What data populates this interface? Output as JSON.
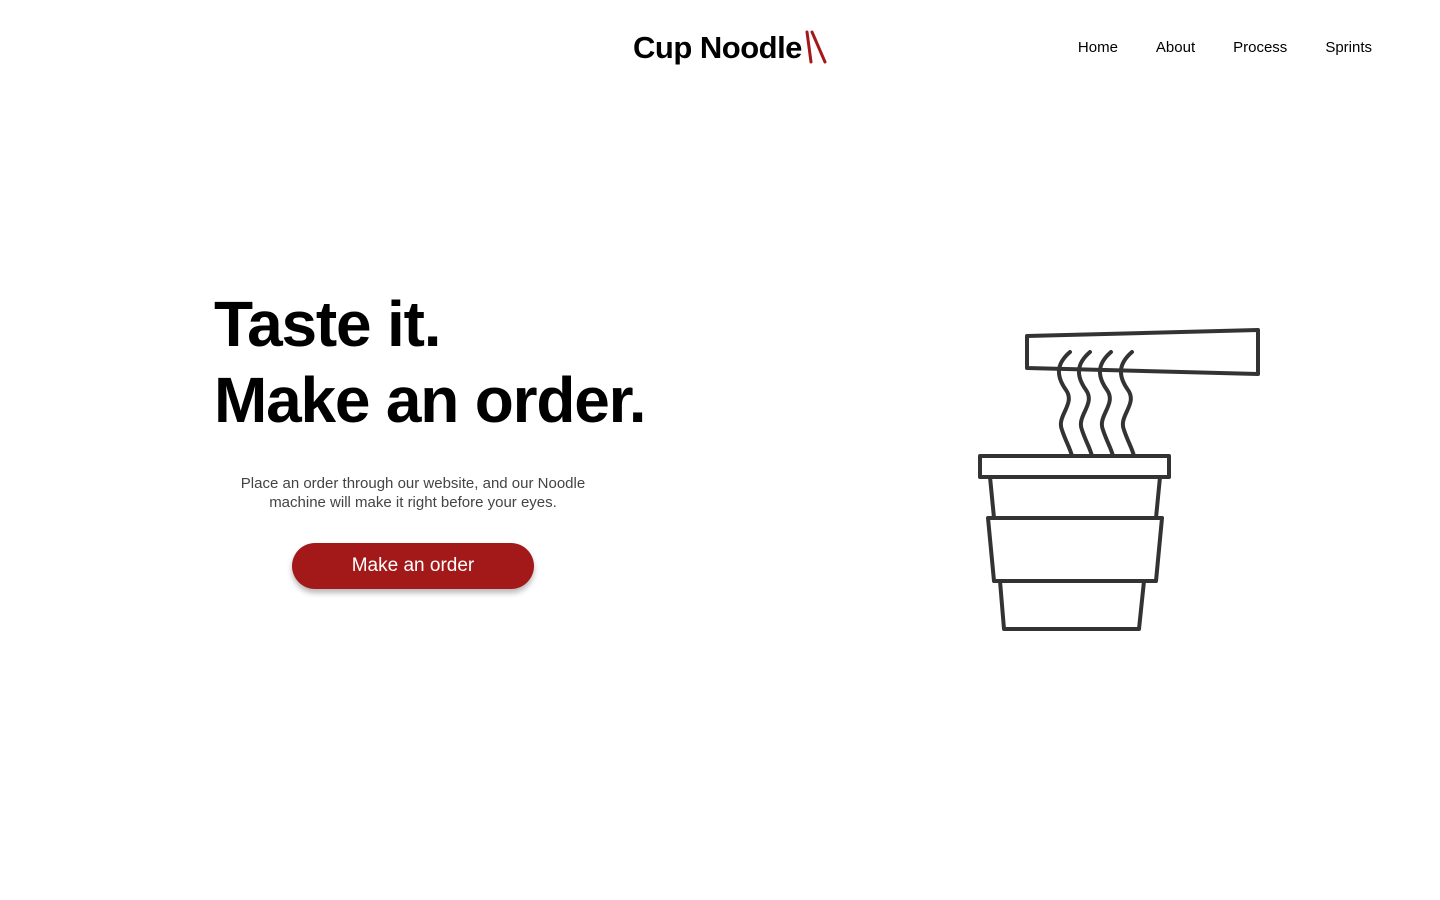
{
  "header": {
    "logo_text": "Cup Noodle",
    "logo_icon": "chopsticks-icon",
    "nav": [
      {
        "label": "Home"
      },
      {
        "label": "About"
      },
      {
        "label": "Process"
      },
      {
        "label": "Sprints"
      }
    ]
  },
  "hero": {
    "title_line1": "Taste it.",
    "title_line2": "Make an order.",
    "subtitle_line1": "Place an order through our website, and our Noodle",
    "subtitle_line2": "machine will make it right before your eyes.",
    "cta_label": "Make an order",
    "illustration_icon": "noodle-cup-icon"
  },
  "colors": {
    "accent": "#a3191a",
    "text": "#000000",
    "subtle_text": "#444444",
    "illustration_stroke": "#333333",
    "background": "#ffffff"
  }
}
